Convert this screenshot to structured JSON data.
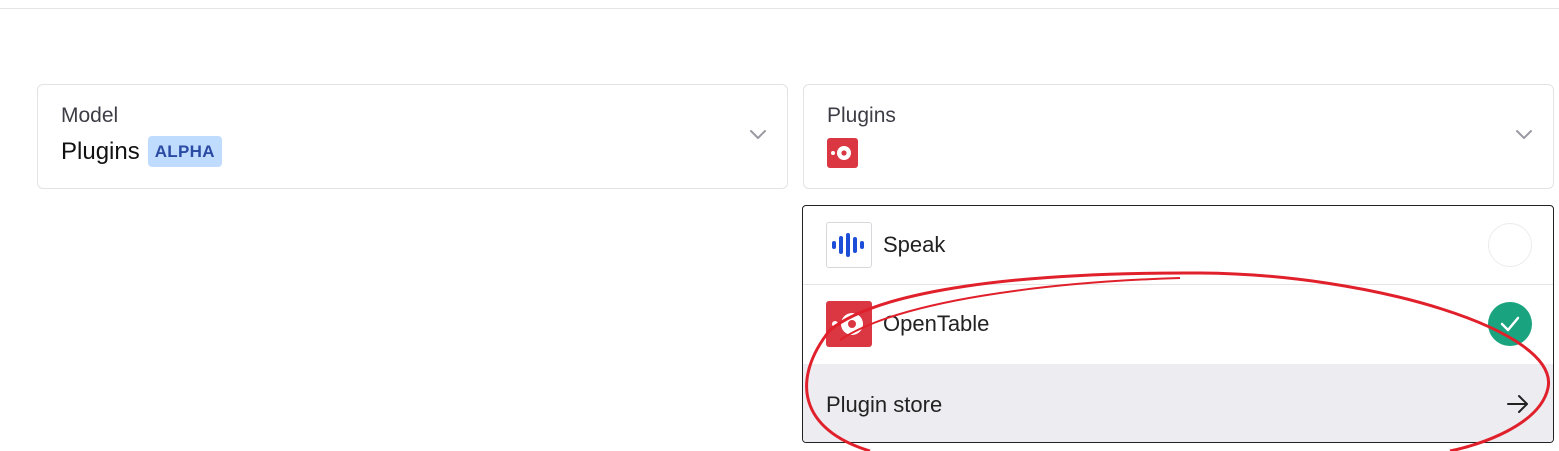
{
  "model": {
    "label": "Model",
    "value": "Plugins",
    "badge": "ALPHA"
  },
  "plugins": {
    "label": "Plugins",
    "selected_icon": "opentable-icon"
  },
  "dropdown": {
    "items": [
      {
        "label": "Speak",
        "icon": "speak-icon",
        "selected": false
      },
      {
        "label": "OpenTable",
        "icon": "opentable-icon",
        "selected": true
      }
    ],
    "store_label": "Plugin store"
  },
  "colors": {
    "accent_green": "#19a37f",
    "opentable_red": "#da3743",
    "speak_blue": "#1d4ed8",
    "badge_bg": "#bfdbfe",
    "annotation_red": "#e0202b"
  }
}
